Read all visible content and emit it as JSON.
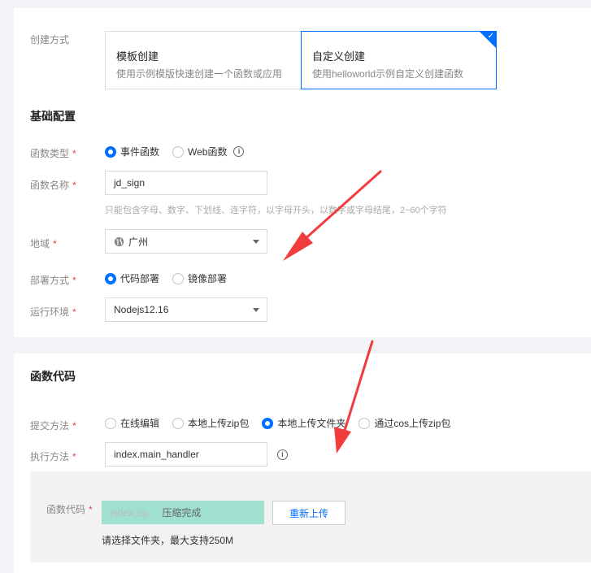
{
  "creation": {
    "label": "创建方式",
    "options": [
      {
        "title": "模板创建",
        "desc": "使用示例模版快速创建一个函数或应用",
        "selected": false
      },
      {
        "title": "自定义创建",
        "desc": "使用helloworld示例自定义创建函数",
        "selected": true
      }
    ]
  },
  "basic": {
    "title": "基础配置",
    "function_type": {
      "label": "函数类型",
      "options": [
        "事件函数",
        "Web函数"
      ],
      "selected": "事件函数"
    },
    "function_name": {
      "label": "函数名称",
      "value": "jd_sign",
      "hint": "只能包含字母、数字、下划线、连字符，以字母开头，以数字或字母结尾，2~60个字符"
    },
    "region": {
      "label": "地域",
      "value": "广州",
      "icon": "globe-icon"
    },
    "deploy_mode": {
      "label": "部署方式",
      "options": [
        "代码部署",
        "镜像部署"
      ],
      "selected": "代码部署"
    },
    "runtime": {
      "label": "运行环境",
      "value": "Nodejs12.16"
    }
  },
  "code": {
    "title": "函数代码",
    "submit_method": {
      "label": "提交方法",
      "options": [
        "在线编辑",
        "本地上传zip包",
        "本地上传文件夹",
        "通过cos上传zip包"
      ],
      "selected": "本地上传文件夹"
    },
    "handler": {
      "label": "执行方法",
      "value": "index.main_handler"
    },
    "upload": {
      "label": "函数代码",
      "file_name": "index.zip",
      "status": "压缩完成",
      "reupload_label": "重新上传",
      "note": "请选择文件夹，最大支持250M"
    }
  },
  "colors": {
    "accent": "#006eff",
    "required": "#e54545",
    "progress": "#9fe0cf",
    "arrow": "#f03c3c"
  }
}
